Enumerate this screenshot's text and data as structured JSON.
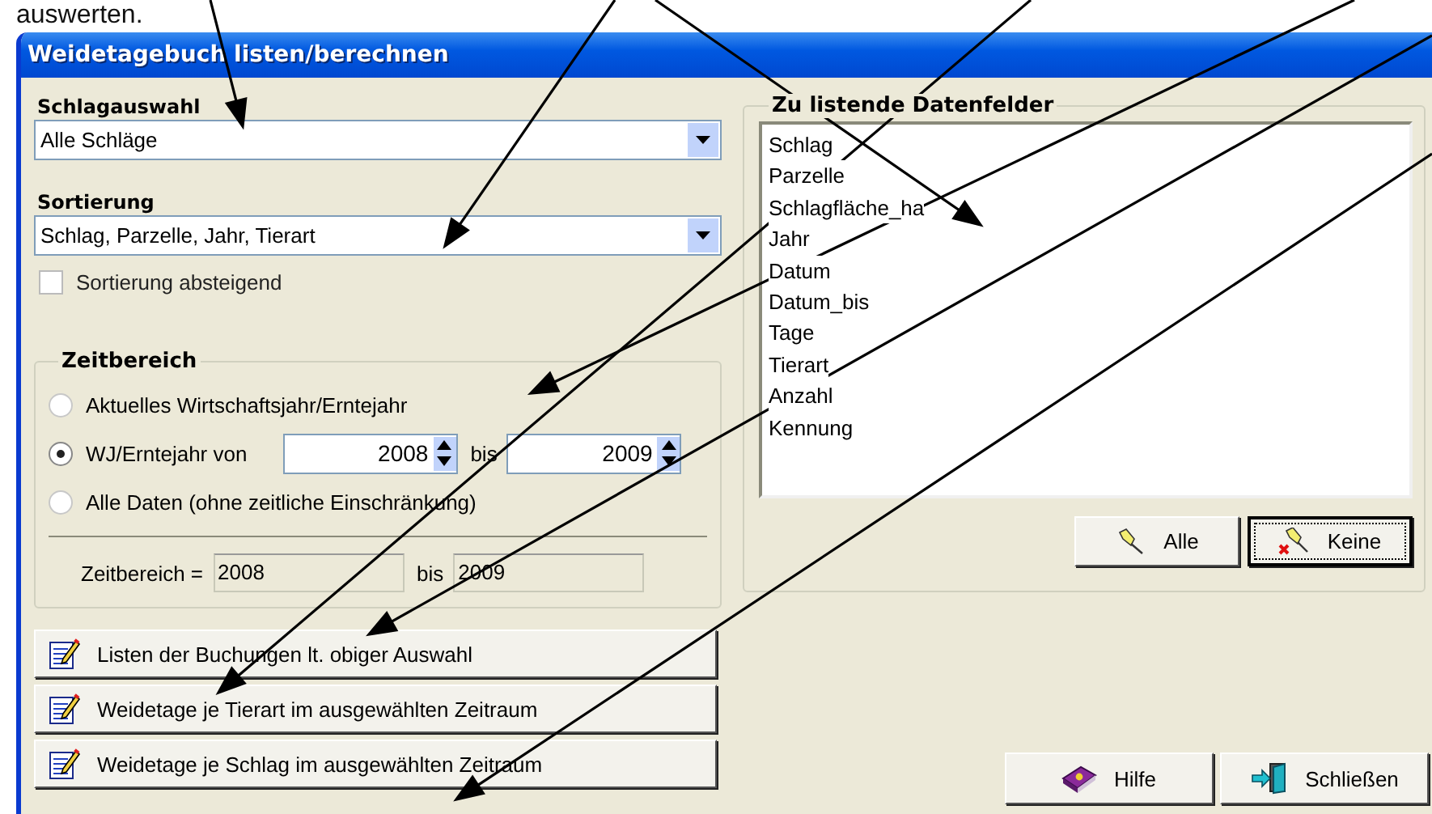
{
  "caption": "auswerten.",
  "window": {
    "title": "Weidetagebuch listen/berechnen"
  },
  "schlagauswahl": {
    "label": "Schlagauswahl",
    "value": "Alle Schläge"
  },
  "sortierung": {
    "label": "Sortierung",
    "value": "Schlag, Parzelle, Jahr, Tierart"
  },
  "sort_descending": {
    "label": "Sortierung absteigend",
    "checked": false
  },
  "zeitbereich": {
    "title": "Zeitbereich",
    "options": [
      {
        "kind": "plain",
        "label": "Aktuelles Wirtschaftsjahr/Erntejahr",
        "selected": false
      },
      {
        "kind": "range",
        "label": "WJ/Erntejahr von",
        "selected": true
      },
      {
        "kind": "plain",
        "label": "Alle Daten (ohne zeitliche Einschränkung)",
        "selected": false
      }
    ],
    "from": "2008",
    "to_label": "bis",
    "to": "2009",
    "summary_label": "Zeitbereich =",
    "summary_from": "2008",
    "summary_to_label": "bis",
    "summary_to": "2009"
  },
  "report_buttons": [
    {
      "label": "Listen der Buchungen lt. obiger Auswahl"
    },
    {
      "label": "Weidetage je Tierart im ausgewählten Zeitraum"
    },
    {
      "label": "Weidetage je Schlag im ausgewählten Zeitraum"
    }
  ],
  "datenfelder": {
    "title": "Zu listende Datenfelder",
    "items": [
      "Schlag",
      "Parzelle",
      "Schlagfläche_ha",
      "Jahr",
      "Datum",
      "Datum_bis",
      "Tage",
      "Tierart",
      "Anzahl",
      "Kennung"
    ],
    "buttons": [
      {
        "kind": "all",
        "label": "Alle",
        "focused": false
      },
      {
        "kind": "none",
        "label": "Keine",
        "focused": true
      }
    ]
  },
  "footer_buttons": [
    {
      "kind": "help",
      "label": "Hilfe"
    },
    {
      "kind": "close",
      "label": "Schließen"
    }
  ]
}
